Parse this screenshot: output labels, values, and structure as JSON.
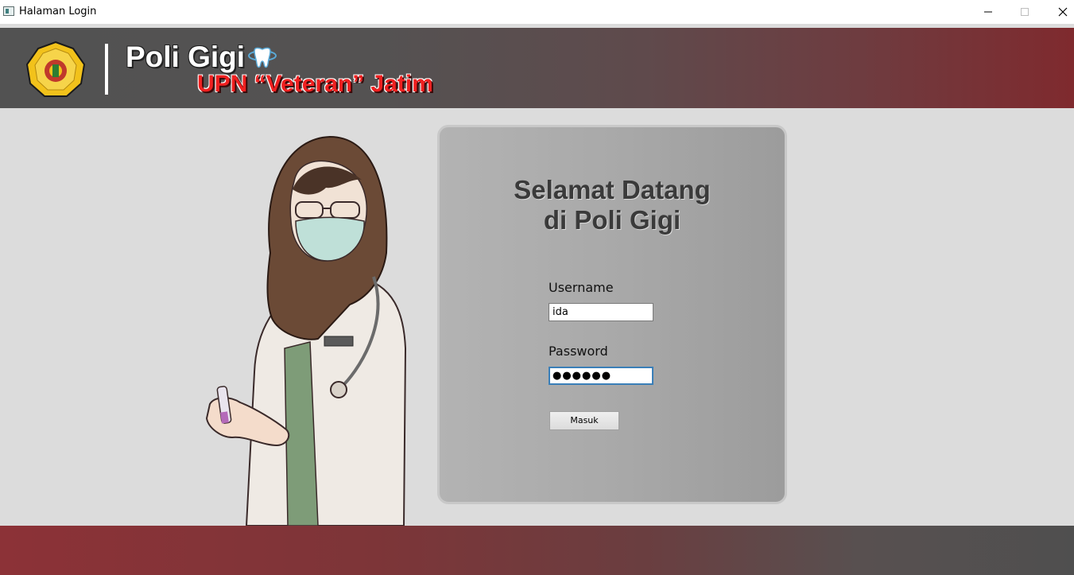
{
  "window": {
    "title": "Halaman Login",
    "controls": {
      "minimize": "—",
      "maximize": "☐",
      "close": "✕"
    }
  },
  "header": {
    "brand": "Poli Gigi",
    "sub_brand": "UPN “Veteran” Jatim",
    "logo_icon": "university-seal-icon",
    "tooth_icon": "tooth-icon"
  },
  "login": {
    "welcome_line1": "Selamat Datang",
    "welcome_line2": "di Poli Gigi",
    "username_label": "Username",
    "username_value": "ida",
    "password_label": "Password",
    "password_value": "●●●●●●",
    "submit_label": "Masuk"
  },
  "colors": {
    "header_dark": "#525252",
    "header_red": "#7f2a2e",
    "brand_red": "#ef2020",
    "panel_gray": "#a9a9a9"
  }
}
